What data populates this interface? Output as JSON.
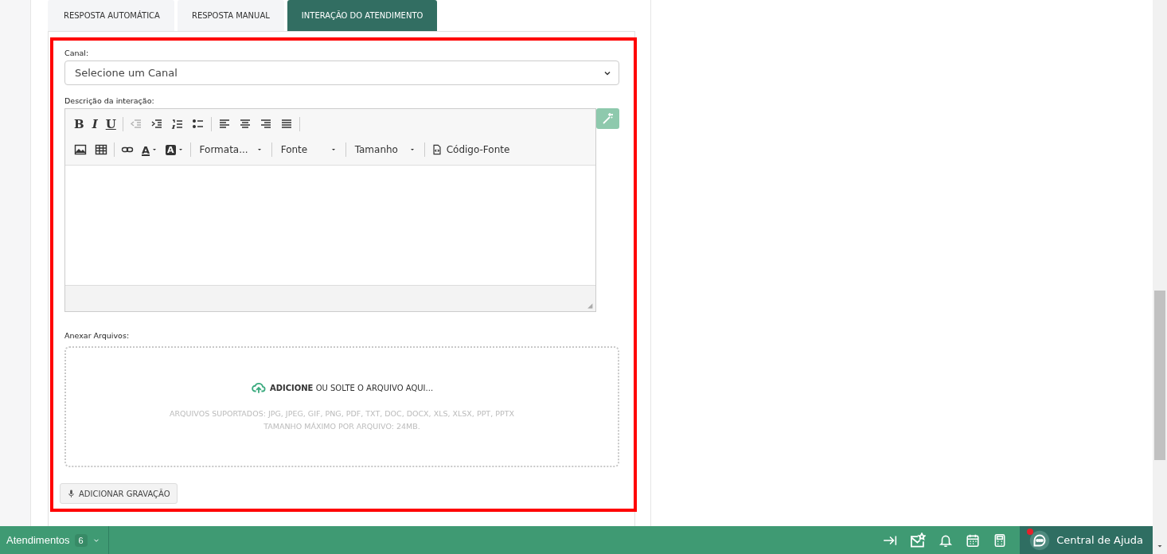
{
  "tabs": [
    {
      "label": "RESPOSTA AUTOMÁTICA",
      "selected": false
    },
    {
      "label": "RESPOSTA MANUAL",
      "selected": false
    },
    {
      "label": "INTERAÇÃO DO ATENDIMENTO",
      "selected": true
    }
  ],
  "form": {
    "highlighted": true,
    "channel": {
      "label": "Canal:",
      "value": "Selecione um Canal"
    },
    "description": {
      "label": "Descrição da interação:",
      "toolbar_rows": [
        [
          {
            "kind": "bold",
            "label": "B",
            "disabled": false
          },
          {
            "kind": "italic",
            "label": "I",
            "disabled": false
          },
          {
            "kind": "underline",
            "label": "U",
            "disabled": false
          },
          {
            "kind": "sep"
          },
          {
            "kind": "outdent",
            "disabled": true
          },
          {
            "kind": "indent",
            "disabled": false
          },
          {
            "kind": "numlist",
            "disabled": false
          },
          {
            "kind": "bullist",
            "disabled": false
          },
          {
            "kind": "sep"
          },
          {
            "kind": "alignleft",
            "disabled": false
          },
          {
            "kind": "aligncenter",
            "disabled": false
          },
          {
            "kind": "alignright",
            "disabled": false
          },
          {
            "kind": "justify",
            "disabled": false
          },
          {
            "kind": "sep"
          }
        ],
        [
          {
            "kind": "image",
            "disabled": false
          },
          {
            "kind": "table",
            "disabled": false
          },
          {
            "kind": "sep"
          },
          {
            "kind": "link",
            "disabled": false
          },
          {
            "kind": "textcolor",
            "label": "A",
            "disabled": false
          },
          {
            "kind": "bgcolor",
            "label": "A",
            "disabled": false
          },
          {
            "kind": "sep"
          },
          {
            "kind": "dropdown",
            "label": "Formata...",
            "disabled": false
          },
          {
            "kind": "sep"
          },
          {
            "kind": "dropdown",
            "label": "Fonte",
            "disabled": false
          },
          {
            "kind": "sep"
          },
          {
            "kind": "dropdown",
            "label": "Tamanho",
            "disabled": false
          },
          {
            "kind": "sep"
          },
          {
            "kind": "source",
            "label": "Código-Fonte",
            "disabled": false
          }
        ]
      ]
    },
    "attachments": {
      "label": "Anexar Arquivos:",
      "action": "ADICIONE",
      "action_rest": "OU SOLTE O ARQUIVO AQUI...",
      "supported": "ARQUIVOS SUPORTADOS: JPG, JPEG, GIF, PNG, PDF, TXT, DOC, DOCX, XLS, XLSX, PPT, PPTX",
      "max_size": "TAMANHO MÁXIMO POR ARQUIVO: 24MB."
    },
    "record_button": "ADICIONAR GRAVAÇÃO"
  },
  "bottom_bar": {
    "label": "Atendimentos",
    "count": "6",
    "help": {
      "label": "Central de Ajuda",
      "notification": true
    }
  }
}
